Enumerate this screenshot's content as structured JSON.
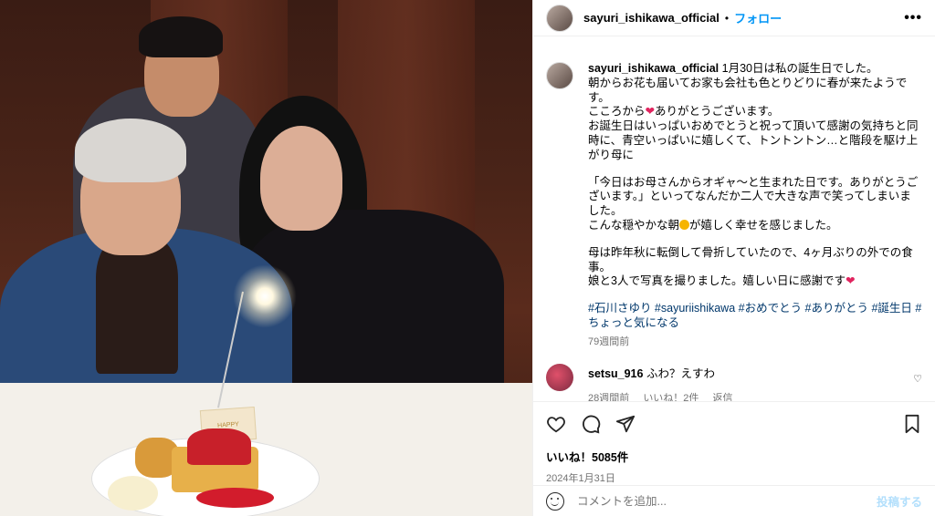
{
  "post": {
    "image_card_text": "HAPPY BIRTHDAY"
  },
  "header": {
    "username": "sayuri_ishikawa_official",
    "separator": "•",
    "follow_label": "フォロー",
    "more_icon": "more-horizontal-icon"
  },
  "caption": {
    "username": "sayuri_ishikawa_official",
    "line1": "1月30日は私の誕生日でした。",
    "line2": "朝からお花も届いてお家も会社も色とりどりに春が来たようです。",
    "line3_a": "こころから",
    "line3_b": "ありがとうございます。",
    "line4": "お誕生日はいっぱいおめでとうと祝って頂いて感謝の気持ちと同時に、青空いっぱいに嬉しくて、トントントン…と階段を駆け上がり母に",
    "line5": "「今日はお母さんからオギャ〜と生まれた日です。ありがとうございます。」といってなんだか二人で大きな声で笑ってしまいました。",
    "line6_a": "こんな穏やかな朝",
    "line6_b": "が嬉しく幸せを感じました。",
    "line7": "母は昨年秋に転倒して骨折していたので、4ヶ月ぶりの外での食事。",
    "line8_a": "娘と3人で写真を撮りました。嬉しい日に感謝です",
    "hashtags": "#石川さゆり #sayuriishikawa #おめでとう #ありがとう #誕生日 #ちょっと気になる",
    "time": "79週間前"
  },
  "comment": {
    "username": "setsu_916",
    "text": "ふわ？えすわ",
    "time": "28週間前",
    "likes": "いいね！2件",
    "reply": "返信"
  },
  "actions": {
    "likes": "いいね！5085件",
    "date": "2024年1月31日"
  },
  "add_comment": {
    "placeholder": "コメントを追加...",
    "post_label": "投稿する"
  },
  "colors": {
    "accent": "#0095f6",
    "link": "#00376b",
    "heart": "#e0245e",
    "muted": "#737373"
  }
}
